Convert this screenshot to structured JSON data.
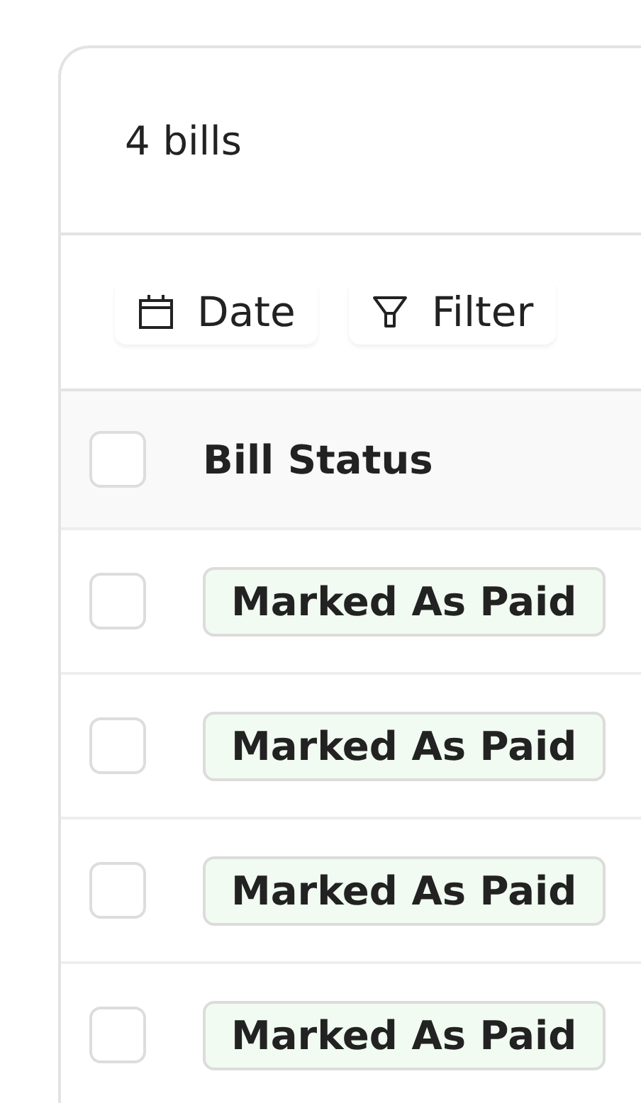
{
  "header": {
    "title": "4 bills"
  },
  "toolbar": [
    {
      "kind": "date",
      "label": "Date"
    },
    {
      "kind": "filter",
      "label": "Filter"
    }
  ],
  "table": {
    "select_all": {
      "checked": false
    },
    "columns": [
      "Bill Status"
    ],
    "rows": [
      {
        "checked": false,
        "status": "Marked As Paid"
      },
      {
        "checked": false,
        "status": "Marked As Paid"
      },
      {
        "checked": false,
        "status": "Marked As Paid"
      },
      {
        "checked": false,
        "status": "Marked As Paid"
      }
    ]
  }
}
